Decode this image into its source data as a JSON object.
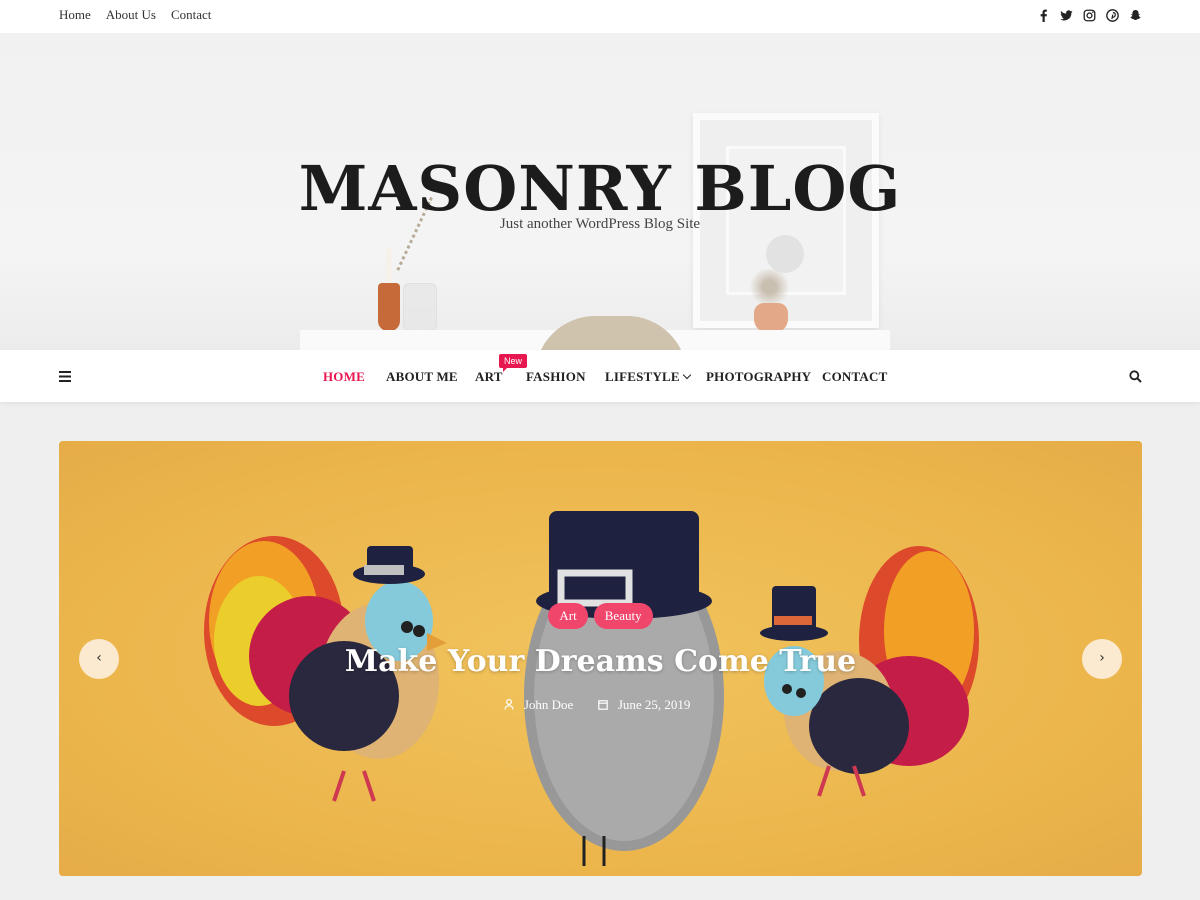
{
  "topbar": {
    "links": [
      "Home",
      "About Us",
      "Contact"
    ],
    "social_icons": [
      "facebook-icon",
      "twitter-icon",
      "instagram-icon",
      "pinterest-icon",
      "snapchat-icon"
    ]
  },
  "site": {
    "title": "MASONRY BLOG",
    "tagline": "Just another WordPress Blog Site"
  },
  "nav": {
    "items": [
      "HOME",
      "ABOUT ME",
      "ART",
      "FASHION",
      "LIFESTYLE",
      "PHOTOGRAPHY",
      "CONTACT"
    ],
    "active": "HOME",
    "badge": "New"
  },
  "slider": {
    "tags": [
      "Art",
      "Beauty"
    ],
    "title": "Make Your Dreams Come True",
    "author": "John Doe",
    "date": "June 25, 2019",
    "prev": "‹",
    "next": "›"
  },
  "colors": {
    "accent": "#e7174f",
    "tag": "#f0466c",
    "slide_bg": "#f2bf55"
  }
}
